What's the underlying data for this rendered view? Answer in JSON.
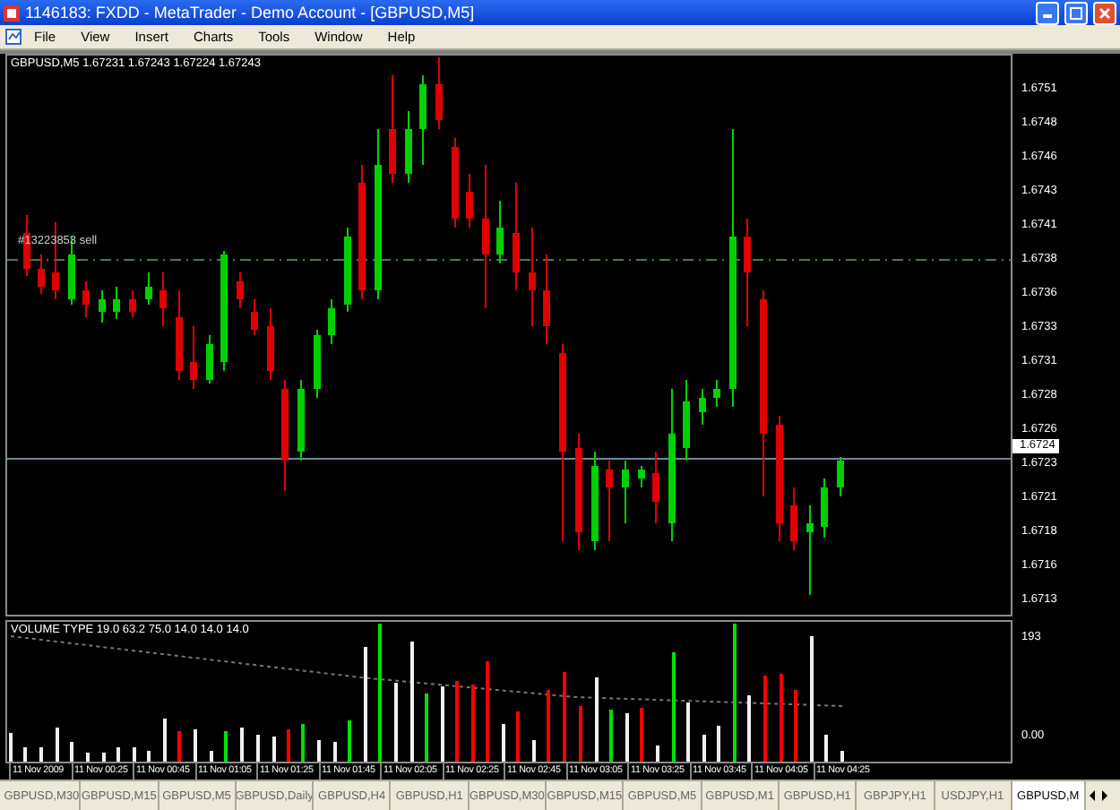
{
  "window": {
    "title": "1146183: FXDD - MetaTrader - Demo Account - [GBPUSD,M5]"
  },
  "menu": [
    "File",
    "View",
    "Insert",
    "Charts",
    "Tools",
    "Window",
    "Help"
  ],
  "chart": {
    "header": "GBPUSD,M5  1.67231 1.67243 1.67224 1.67243",
    "order_label": "#13223853 sell",
    "price_ticks": [
      "1.6751",
      "1.6748",
      "1.6746",
      "1.6743",
      "1.6741",
      "1.6738",
      "1.6736",
      "1.6733",
      "1.6731",
      "1.6728",
      "1.6726",
      "1.6723",
      "1.6721",
      "1.6718",
      "1.6716",
      "1.6713"
    ],
    "bid_label": "1.6724"
  },
  "volume": {
    "label": "VOLUME TYPE 19.0 63.2 75.0 14.0 14.0 14.0",
    "ticks": [
      "193",
      "0.00"
    ]
  },
  "time_axis": [
    "11 Nov 2009",
    "11 Nov 00:25",
    "11 Nov 00:45",
    "11 Nov 01:05",
    "11 Nov 01:25",
    "11 Nov 01:45",
    "11 Nov 02:05",
    "11 Nov 02:25",
    "11 Nov 02:45",
    "11 Nov 03:05",
    "11 Nov 03:25",
    "11 Nov 03:45",
    "11 Nov 04:05",
    "11 Nov 04:25"
  ],
  "tabs": [
    {
      "label": "GBPUSD,M30",
      "selected": false
    },
    {
      "label": "GBPUSD,M15",
      "selected": false
    },
    {
      "label": "GBPUSD,M5",
      "selected": false
    },
    {
      "label": "GBPUSD,Daily",
      "selected": false
    },
    {
      "label": "GBPUSD,H4",
      "selected": false
    },
    {
      "label": "GBPUSD,H1",
      "selected": false
    },
    {
      "label": "GBPUSD,M30",
      "selected": false
    },
    {
      "label": "GBPUSD,M15",
      "selected": false
    },
    {
      "label": "GBPUSD,M5",
      "selected": false
    },
    {
      "label": "GBPUSD,M1",
      "selected": false
    },
    {
      "label": "GBPUSD,H1",
      "selected": false
    },
    {
      "label": "GBPJPY,H1",
      "selected": false
    },
    {
      "label": "USDJPY,H1",
      "selected": false
    },
    {
      "label": "GBPUSD,M",
      "selected": true
    }
  ]
}
